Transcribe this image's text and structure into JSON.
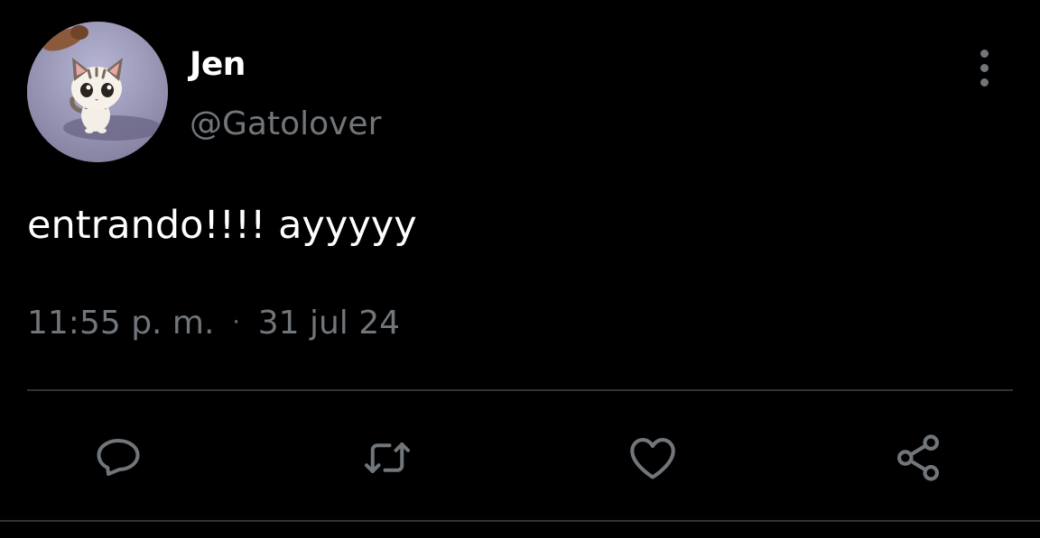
{
  "tweet": {
    "author": {
      "display_name": "Jen",
      "handle": "@Gatolover",
      "avatar": "cat-cartoon-avatar"
    },
    "text": "entrando!!!! ayyyyy",
    "time": "11:55 p. m.",
    "separator": "·",
    "date": "31 jul 24"
  },
  "actions": [
    {
      "icon": "reply-icon"
    },
    {
      "icon": "retweet-icon"
    },
    {
      "icon": "like-icon"
    },
    {
      "icon": "share-icon"
    }
  ],
  "colors": {
    "background": "#000000",
    "primary_text": "#ffffff",
    "secondary_text": "#71767b",
    "divider": "#2f3336"
  }
}
